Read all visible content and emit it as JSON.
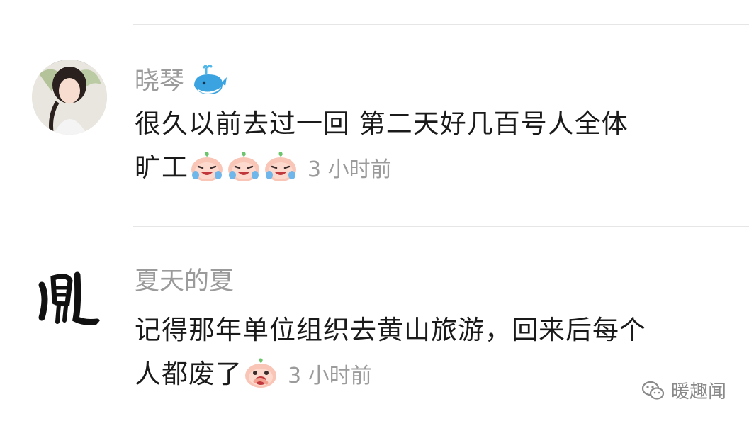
{
  "comments": [
    {
      "username": "晓琴",
      "username_badge": "whale-emoji-icon",
      "text_line1": "很久以前去过一回  第二天好几百号人全体",
      "text_line2": "旷工",
      "emojis": [
        "crying-peach-emoji-icon",
        "crying-peach-emoji-icon",
        "crying-peach-emoji-icon"
      ],
      "time": "3 小时前",
      "avatar": "user-photo-avatar"
    },
    {
      "username": "夏天的夏",
      "text_line1": "记得那年单位组织去黄山旅游，回来后每个",
      "text_line2": "人都废了",
      "emojis": [
        "covering-mouth-peach-emoji-icon"
      ],
      "time": "3 小时前",
      "avatar": "calligraphy-avatar",
      "avatar_glyph": "亂"
    }
  ],
  "watermark": {
    "icon": "wechat-icon",
    "label": "暖趣闻"
  },
  "colors": {
    "username": "#9b9b9b",
    "text": "#1a1a1a",
    "time": "#9b9b9b",
    "divider": "#e6e6e6"
  }
}
